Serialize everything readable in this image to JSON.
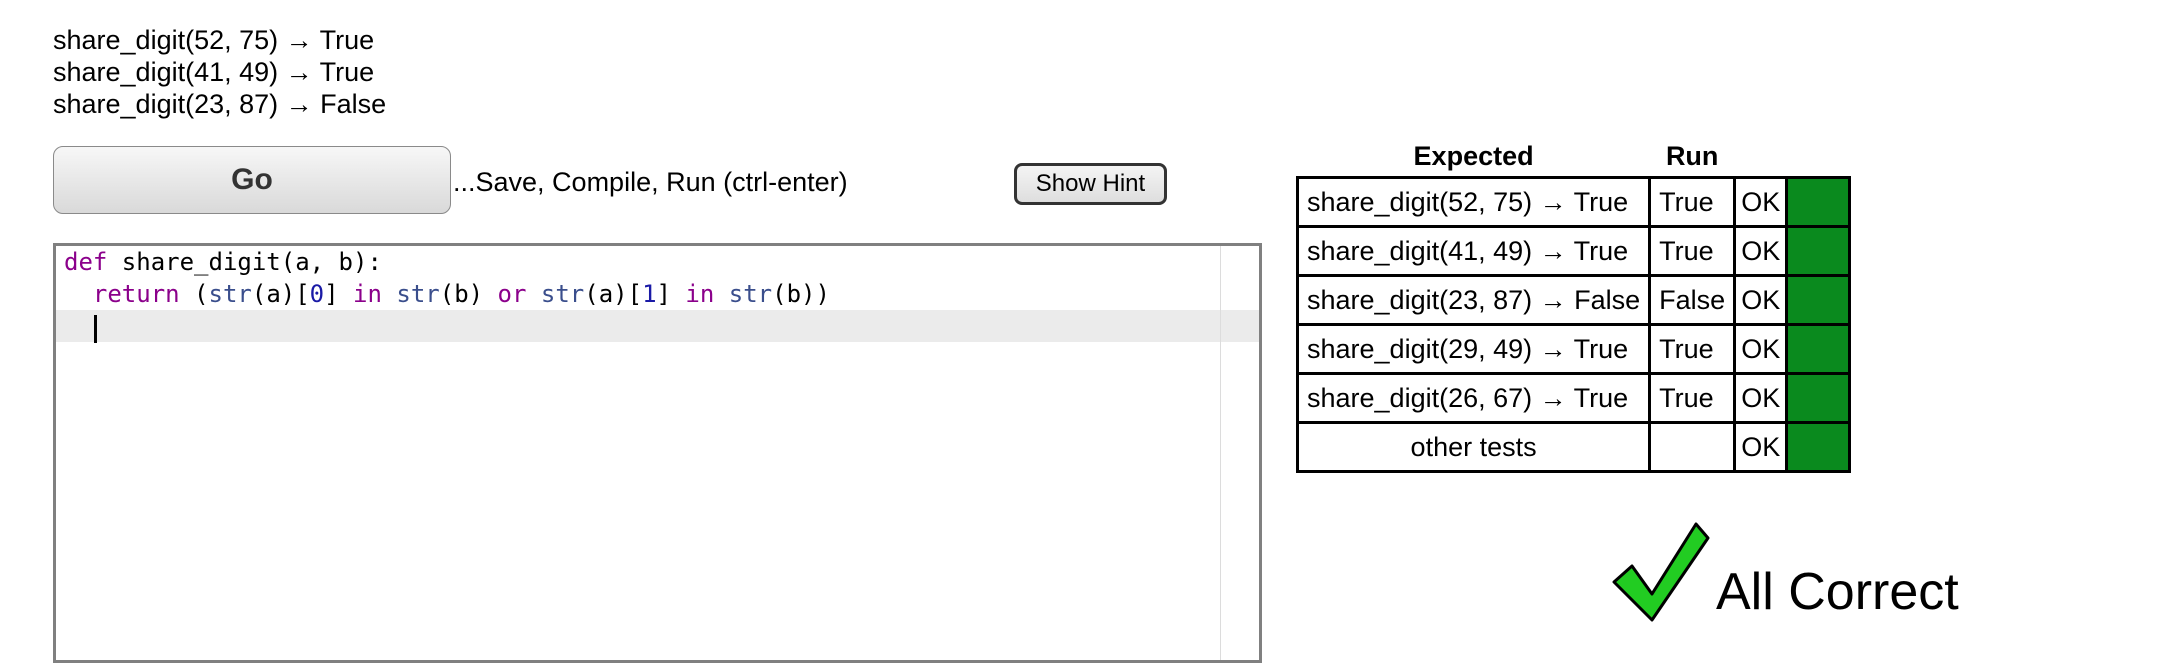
{
  "examples": [
    "share_digit(52, 75) → True",
    "share_digit(41, 49) → True",
    "share_digit(23, 87) → False"
  ],
  "toolbar": {
    "go_label": "Go",
    "go_caption": "...Save, Compile, Run (ctrl-enter)",
    "hint_label": "Show Hint"
  },
  "editor": {
    "line1": {
      "kw_def": "def",
      "rest": " share_digit(a, b):"
    },
    "line2": {
      "indent": "  ",
      "kw_return": "return",
      "t1": " (",
      "str1": "str",
      "t2": "(a)[",
      "n0": "0",
      "t3": "] ",
      "kw_in1": "in",
      "t4": " ",
      "str2": "str",
      "t5": "(b) ",
      "kw_or": "or",
      "t6": " ",
      "str3": "str",
      "t7": "(a)[",
      "n1": "1",
      "t8": "] ",
      "kw_in2": "in",
      "t9": " ",
      "str4": "str",
      "t10": "(b))"
    }
  },
  "results": {
    "headers": {
      "expected": "Expected",
      "run": "Run"
    },
    "rows": [
      {
        "expected": "share_digit(52, 75) → True",
        "run": "True",
        "status": "OK"
      },
      {
        "expected": "share_digit(41, 49) → True",
        "run": "True",
        "status": "OK"
      },
      {
        "expected": "share_digit(23, 87) → False",
        "run": "False",
        "status": "OK"
      },
      {
        "expected": "share_digit(29, 49) → True",
        "run": "True",
        "status": "OK"
      },
      {
        "expected": "share_digit(26, 67) → True",
        "run": "True",
        "status": "OK"
      },
      {
        "expected": "other tests",
        "run": "",
        "status": "OK"
      }
    ],
    "ok_color": "#0a8a1e"
  },
  "summary": {
    "icon": "checkmark-icon",
    "text": "All Correct",
    "check_fill": "#22cc22"
  }
}
